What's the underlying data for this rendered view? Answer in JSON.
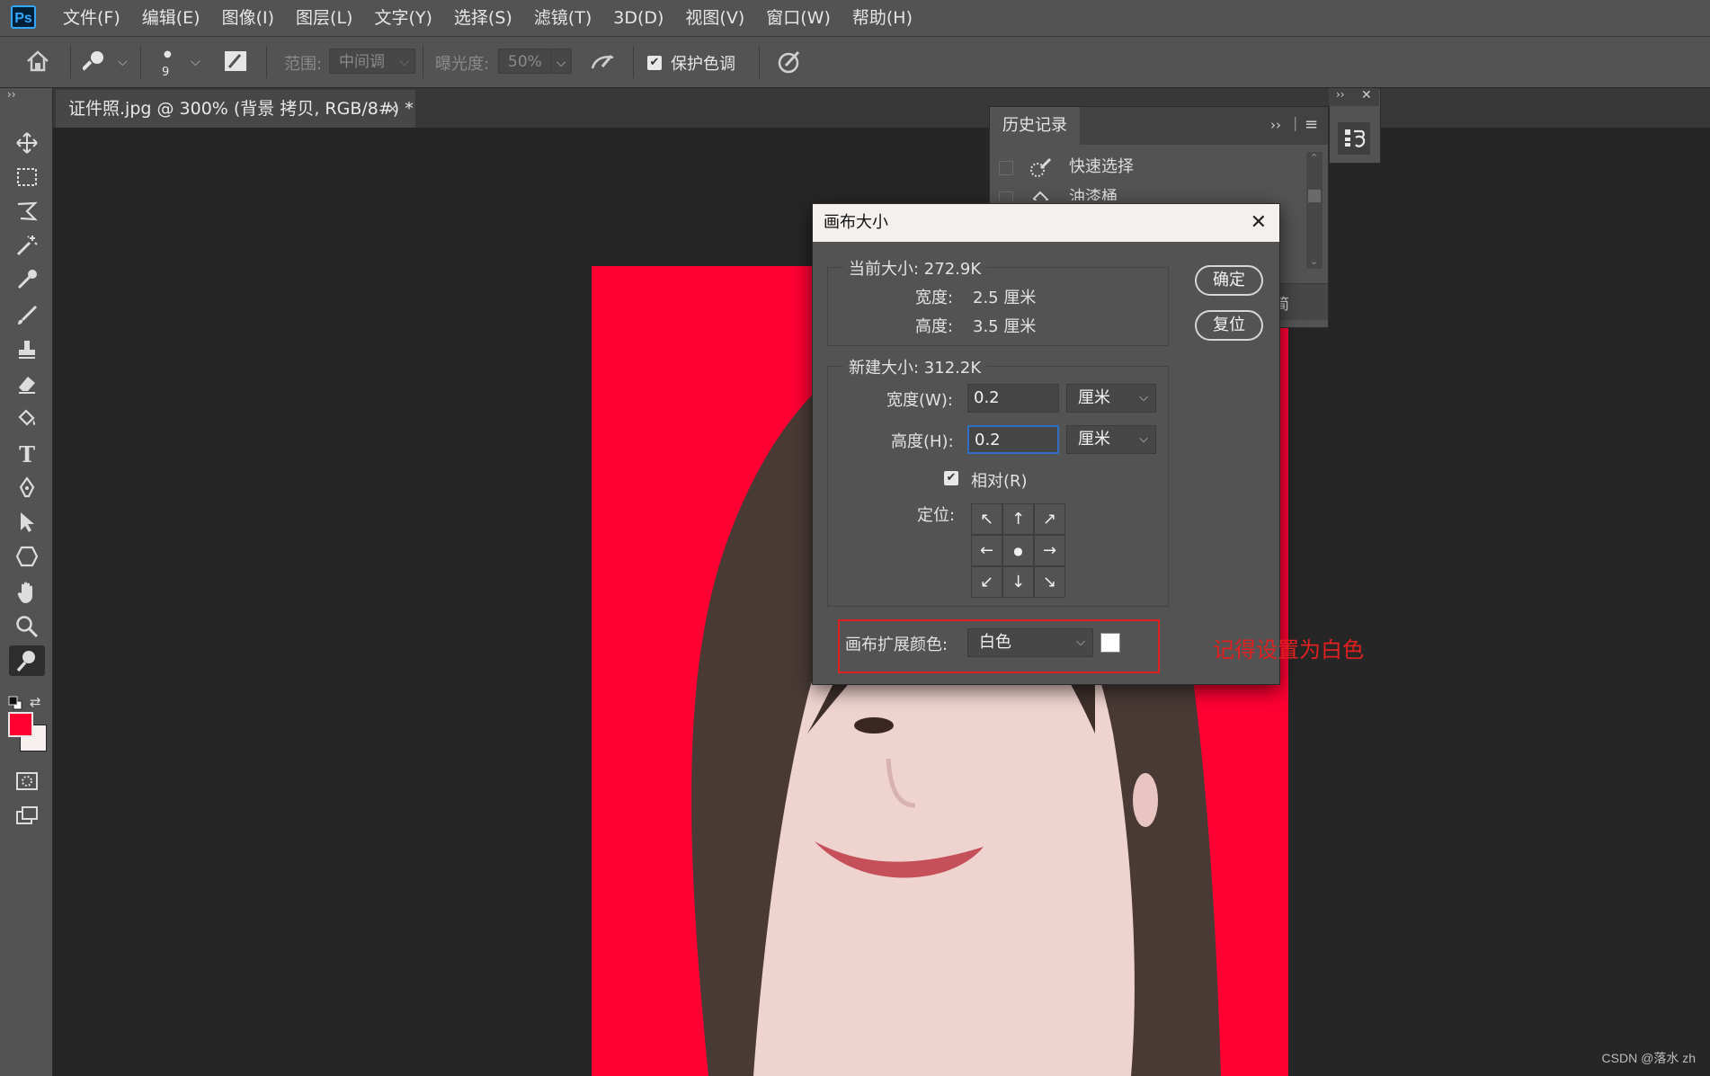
{
  "app": {
    "logo": "Ps",
    "menu": [
      "文件(F)",
      "编辑(E)",
      "图像(I)",
      "图层(L)",
      "文字(Y)",
      "选择(S)",
      "滤镜(T)",
      "3D(D)",
      "视图(V)",
      "窗口(W)",
      "帮助(H)"
    ]
  },
  "options": {
    "brush_size": "9",
    "range_label": "范围:",
    "range_value": "中间调",
    "exposure_label": "曝光度:",
    "exposure_value": "50%",
    "protect_tone_label": "保护色调",
    "protect_tone_checked": true
  },
  "document": {
    "tab_title": "证件照.jpg @ 300% (背景 拷贝, RGB/8#) *",
    "close_glyph": "×"
  },
  "colors": {
    "foreground": "#ff0033",
    "background": "#f5f0ee",
    "photo_background": "#ff0033",
    "annotation": "#e12020"
  },
  "history_panel": {
    "title": "历史记录",
    "items": [
      "快速选择",
      "油漆桶"
    ],
    "truncated_button_text": "简"
  },
  "dialog": {
    "title": "画布大小",
    "current_size_label": "当前大小: 272.9K",
    "current_width_label": "宽度:",
    "current_width_value": "2.5 厘米",
    "current_height_label": "高度:",
    "current_height_value": "3.5 厘米",
    "new_size_label": "新建大小: 312.2K",
    "width_label": "宽度(W):",
    "width_value": "0.2",
    "width_unit": "厘米",
    "height_label": "高度(H):",
    "height_value": "0.2",
    "height_unit": "厘米",
    "relative_label": "相对(R)",
    "relative_checked": true,
    "anchor_label": "定位:",
    "anchor_arrows": [
      "↖",
      "↑",
      "↗",
      "←",
      "●",
      "→",
      "↙",
      "↓",
      "↘"
    ],
    "extension_color_label": "画布扩展颜色:",
    "extension_color_value": "白色",
    "extension_swatch": "#ffffff",
    "ok_label": "确定",
    "reset_label": "复位"
  },
  "annotation": "记得设置为白色",
  "watermark": "CSDN @落水 zh"
}
